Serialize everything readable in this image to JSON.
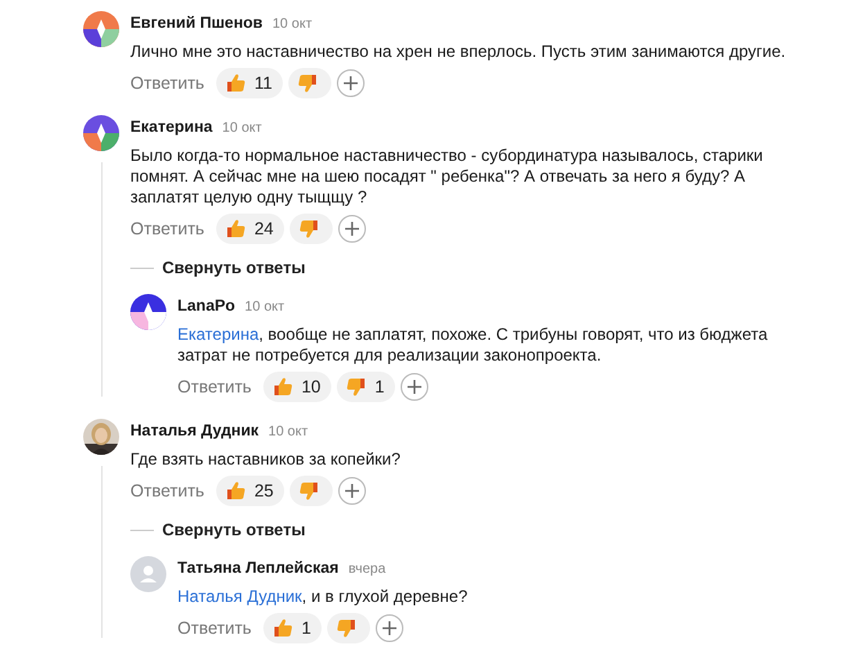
{
  "comments": [
    {
      "author": "Евгений Пшенов",
      "date": "10 окт",
      "avatar": {
        "kind": "pattern"
      },
      "text": "Лично мне это наставничество на хрен не вперлось. Пусть этим занимаются другие.",
      "reply_label": "Ответить",
      "likes": "11"
    },
    {
      "author": "Екатерина",
      "date": "10 окт",
      "avatar": {
        "kind": "pattern"
      },
      "text": "Было когда-то нормальное наставничество - субординатура называлось, старики помнят. А сейчас мне на шею посадят \" ребенка\"? А отвечать за него я буду? А заплатят целую одну тыщщу ?",
      "reply_label": "Ответить",
      "likes": "24",
      "collapse_label": "Свернуть ответы",
      "children": [
        {
          "author": "LanaPo",
          "date": "10 окт",
          "avatar": {
            "kind": "pattern"
          },
          "mention": "Екатерина",
          "text": ", вообще не заплатят, похоже. С трибуны говорят, что из бюджета затрат не потребуется для реализации законопроекта.",
          "reply_label": "Ответить",
          "likes": "10",
          "dislikes": "1"
        }
      ]
    },
    {
      "author": "Наталья Дудник",
      "date": "10 окт",
      "text": "Где взять наставников за копейки?",
      "reply_label": "Ответить",
      "likes": "25",
      "collapse_label": "Свернуть ответы",
      "children": [
        {
          "author": "Татьяна Леплейская",
          "date": "вчера",
          "avatar": {
            "kind": "placeholder"
          },
          "mention": "Наталья Дудник",
          "text": ", и в глухой деревне?",
          "reply_label": "Ответить",
          "likes": "1"
        }
      ]
    }
  ]
}
